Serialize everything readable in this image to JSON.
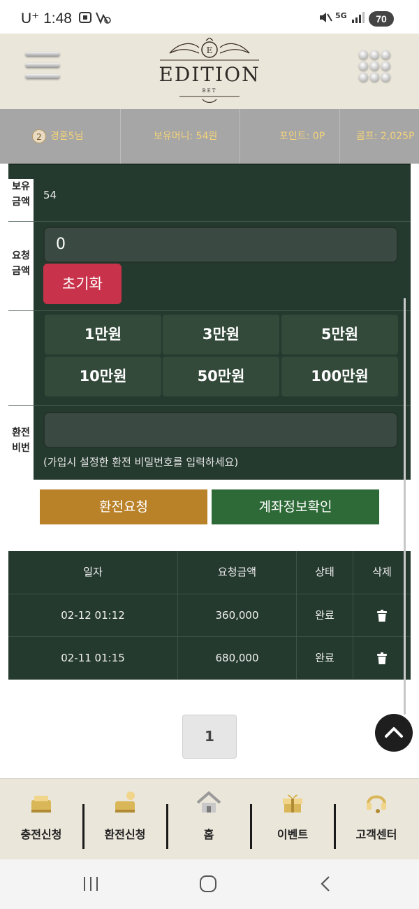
{
  "status_bar": {
    "time": "1:48",
    "carrier": "U⁺",
    "battery": "70",
    "network": "5G"
  },
  "header": {
    "brand": "EDITION",
    "brand_sub": "BET",
    "menu_icon": "hamburger-icon",
    "grid_icon": "grid-dots-icon"
  },
  "user_bar": {
    "level": "2",
    "name": "경훈5님",
    "balance": "보유머니: 54원",
    "points": "포인트: 0P",
    "comp": "콤프: 2,025P",
    "text_color": "#f3d27a"
  },
  "form": {
    "balance_label_1": "보유",
    "balance_label_2": "금액",
    "balance_value": "54",
    "request_label_1": "요청",
    "request_label_2": "금액",
    "request_value": "0",
    "reset_label": "초기화",
    "amount_buttons": [
      "1만원",
      "3만원",
      "5만원",
      "10만원",
      "50만원",
      "100만원"
    ],
    "password_label_1": "환전",
    "password_label_2": "비번",
    "password_value": "",
    "password_hint": "(가입시 설정한 환전 비밀번호를 입력하세요)"
  },
  "actions": {
    "withdraw_label": "환전요청",
    "account_label": "계좌정보확인",
    "withdraw_color": "#b98128",
    "account_color": "#2e6a37"
  },
  "history_table": {
    "headers": [
      "일자",
      "요청금액",
      "상태",
      "삭제"
    ],
    "rows": [
      {
        "date": "02-12 01:12",
        "amount": "360,000",
        "status": "완료",
        "delete_icon": "trash-icon"
      },
      {
        "date": "02-11 01:15",
        "amount": "680,000",
        "status": "완료",
        "delete_icon": "trash-icon"
      }
    ]
  },
  "pagination": {
    "current_page": "1"
  },
  "bottom_nav": {
    "items": [
      {
        "label": "충전신청",
        "icon": "deposit-icon"
      },
      {
        "label": "환전신청",
        "icon": "exchange-icon"
      },
      {
        "label": "홈",
        "icon": "home-icon"
      },
      {
        "label": "이벤트",
        "icon": "gift-icon"
      },
      {
        "label": "고객센터",
        "icon": "support-icon"
      }
    ]
  },
  "colors": {
    "panel": "#253a2f",
    "reset": "#c8334b",
    "header_bg": "#ebe6da",
    "user_bar_bg": "#a6a6a6"
  }
}
